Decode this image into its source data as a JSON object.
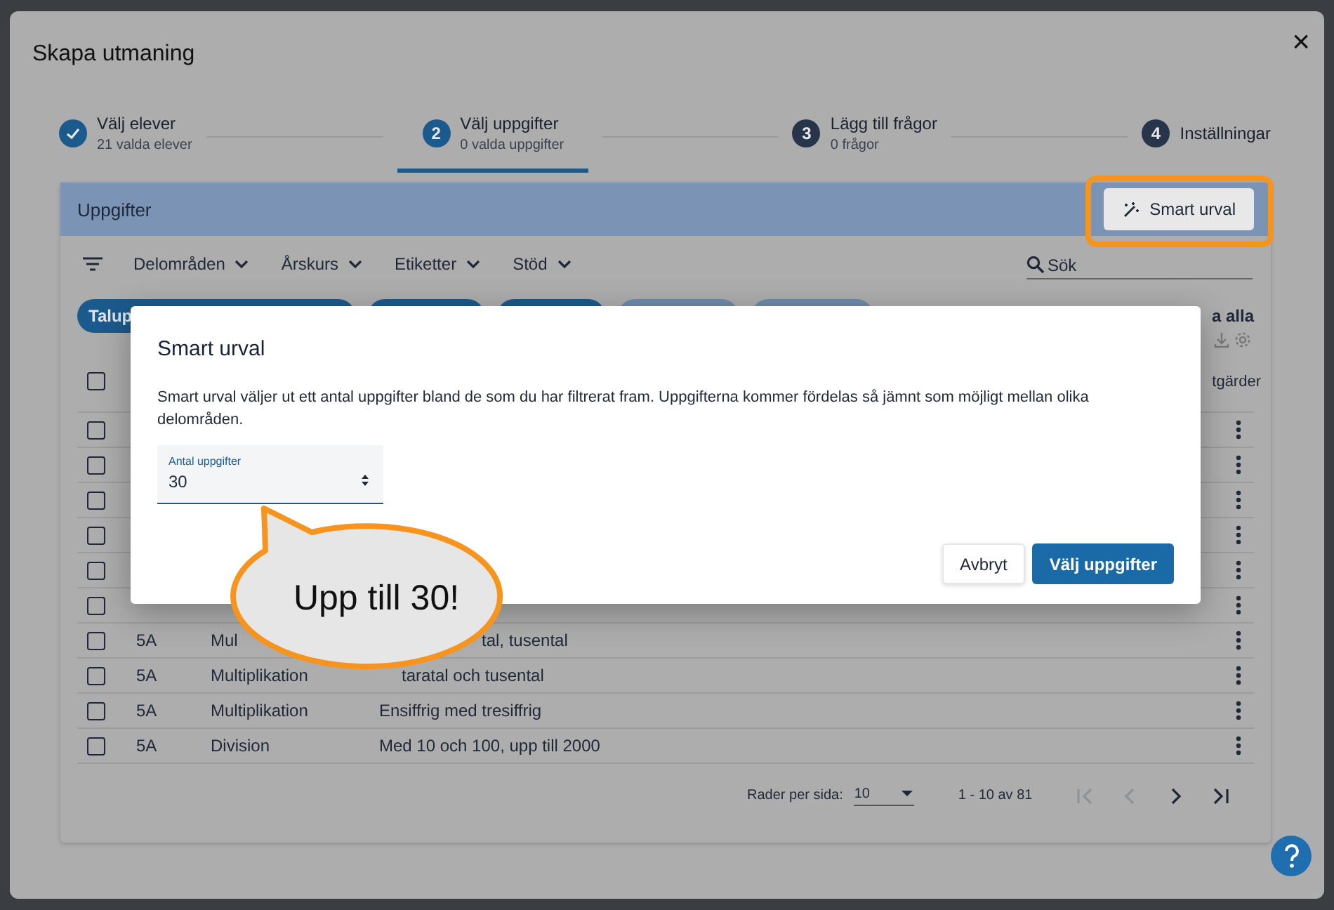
{
  "dialog": {
    "title": "Skapa utmaning",
    "close": "×"
  },
  "steps": [
    {
      "label": "Välj elever",
      "sublabel": "21 valda elever",
      "completed": true,
      "selected": false
    },
    {
      "number": "2",
      "label": "Välj uppgifter",
      "sublabel": "0 valda uppgifter",
      "completed": false,
      "selected": true
    },
    {
      "number": "3",
      "label": "Lägg till frågor",
      "sublabel": "0 frågor",
      "completed": false,
      "selected": false
    },
    {
      "number": "4",
      "label": "Inställningar",
      "completed": false,
      "selected": false
    }
  ],
  "panel": {
    "title": "Uppgifter",
    "smart_button": "Smart urval"
  },
  "filters": [
    "Delområden",
    "Årskurs",
    "Etiketter",
    "Stöd"
  ],
  "search": {
    "placeholder": "Sök"
  },
  "chips": [
    {
      "label": "Talup",
      "selected": true
    },
    {
      "selected": true
    },
    {
      "selected": true
    },
    {
      "selected": false
    },
    {
      "selected": false
    }
  ],
  "clear_link": "a alla",
  "table": {
    "header": {
      "select_all_checked": false,
      "actions": "tgärder"
    },
    "rows": [
      {
        "checked": false
      },
      {
        "checked": false
      },
      {
        "checked": false
      },
      {
        "checked": false
      },
      {
        "checked": false
      },
      {
        "checked": false
      },
      {
        "checked": false,
        "cells": [
          "5A",
          "Mul",
          "tal, tusental"
        ],
        "covered": true
      },
      {
        "checked": false,
        "cells": [
          "5A",
          "Multiplikation",
          "taratal och tusental"
        ],
        "covered": true
      },
      {
        "checked": false,
        "cells": [
          "5A",
          "Multiplikation",
          "Ensiffrig med tresiffrig"
        ]
      },
      {
        "checked": false,
        "cells": [
          "5A",
          "Division",
          "Med 10 och 100, upp till 2000"
        ]
      }
    ]
  },
  "pagination": {
    "rows_label": "Rader per sida:",
    "rows_per_page": "10",
    "range": "1 - 10 av 81",
    "buttons": [
      {
        "kind": "first",
        "disabled": true
      },
      {
        "kind": "prev",
        "disabled": true
      },
      {
        "kind": "next",
        "disabled": false
      },
      {
        "kind": "last",
        "disabled": false
      }
    ]
  },
  "modal": {
    "title": "Smart urval",
    "text": "Smart urval väljer ut ett antal uppgifter bland de som du har filtrerat fram. Uppgifterna kommer fördelas så jämnt som möjligt mellan olika delområden.",
    "field": {
      "label": "Antal uppgifter",
      "value": "30"
    },
    "buttons": [
      {
        "label": "Avbryt",
        "kind": "secondary"
      },
      {
        "label": "Välj uppgifter",
        "kind": "primary"
      }
    ]
  },
  "callout": {
    "text": "Upp till 30!"
  }
}
